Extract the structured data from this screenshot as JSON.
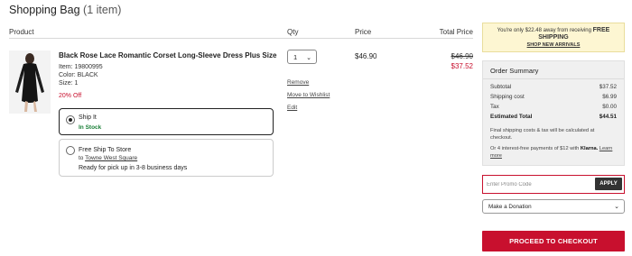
{
  "header": {
    "title": "Shopping Bag",
    "count": "(1 item)"
  },
  "columns": {
    "product": "Product",
    "qty": "Qty",
    "price": "Price",
    "total": "Total Price"
  },
  "item": {
    "name": "Black Rose Lace Romantic Corset Long-Sleeve Dress Plus Size",
    "item_no": "Item: 19800995",
    "color": "Color: BLACK",
    "size": "Size: 1",
    "discount": "20% Off",
    "qty": "1",
    "price": "$46.90",
    "total_original": "$46.90",
    "total_sale": "$37.52",
    "actions": {
      "remove": "Remove",
      "wishlist": "Move to Wishlist",
      "edit": "Edit"
    }
  },
  "fulfillment": {
    "ship": {
      "title": "Ship It",
      "status": "In Stock",
      "selected": true
    },
    "store": {
      "title": "Free Ship To Store",
      "to_prefix": "to ",
      "store_name": "Towne West Square",
      "pickup": "Ready for pick up in 3-8 business days",
      "selected": false
    }
  },
  "free_shipping": {
    "line1": "You're only $22.48 away from receiving",
    "strong": "FREE SHIPPING",
    "link": "SHOP NEW ARRIVALS"
  },
  "summary": {
    "title": "Order Summary",
    "rows": [
      {
        "label": "Subtotal",
        "value": "$37.52"
      },
      {
        "label": "Shipping cost",
        "value": "$6.99"
      },
      {
        "label": "Tax",
        "value": "$0.00"
      },
      {
        "label": "Estimated Total",
        "value": "$44.51"
      }
    ],
    "note": "Final shipping costs & tax will be calculated at checkout.",
    "klarna_prefix": "Or 4 interest-free payments of $12 with",
    "klarna": "Klarna.",
    "learn_more": "Learn more"
  },
  "promo": {
    "placeholder": "Enter Promo Code",
    "apply": "APPLY"
  },
  "donation": {
    "selected": "Make a Donation"
  },
  "checkout": {
    "label": "PROCEED TO CHECKOUT"
  },
  "colors": {
    "accent_red": "#c8102e",
    "in_stock_green": "#1a7f37",
    "banner_yellow": "#fdf6d2"
  }
}
